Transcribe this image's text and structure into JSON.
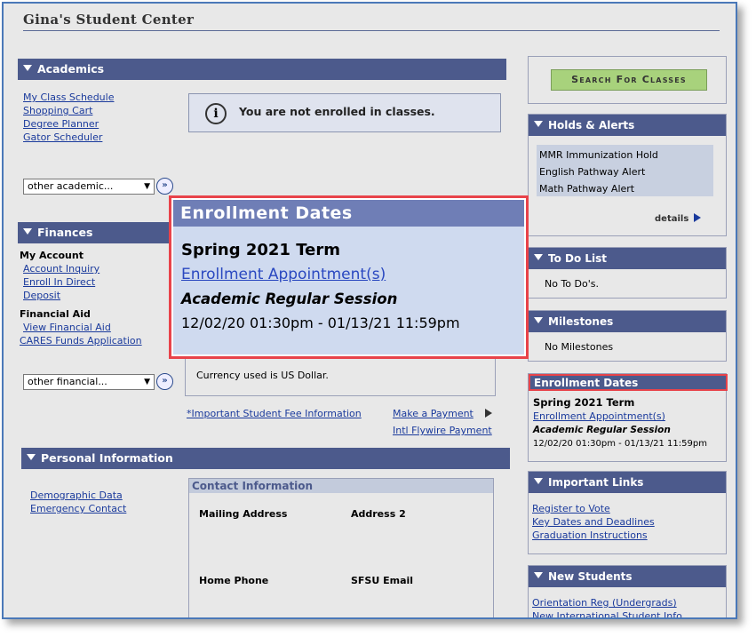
{
  "page_title": "Gina's Student Center",
  "academics": {
    "header": "Academics",
    "links": [
      "My Class Schedule",
      "Shopping Cart",
      "Degree Planner",
      "Gator Scheduler"
    ],
    "not_enrolled": "You are not enrolled in classes.",
    "other_select": "other academic..."
  },
  "finances": {
    "header": "Finances",
    "my_account_label": "My Account",
    "account_links": [
      "Account Inquiry",
      "Enroll In Direct",
      "Deposit"
    ],
    "financial_aid_label": "Financial Aid",
    "aid_links": [
      "View Financial Aid",
      "CARES Funds Application"
    ],
    "other_select": "other financial...",
    "currency_note": "Currency used is US Dollar.",
    "fee_info": "*Important Student Fee Information",
    "make_payment": "Make a Payment",
    "flywire": "Intl Flywire Payment"
  },
  "personal": {
    "header": "Personal Information",
    "links": [
      "Demographic Data",
      "Emergency Contact"
    ],
    "contact_header": "Contact Information",
    "mailing_address": "Mailing Address",
    "address2": "Address 2",
    "home_phone": "Home Phone",
    "sfsu_email": "SFSU Email"
  },
  "search_classes": "Search For Classes",
  "holds": {
    "header": "Holds & Alerts",
    "items": [
      "MMR Immunization Hold",
      "English Pathway Alert",
      "Math Pathway Alert"
    ],
    "details": "details"
  },
  "todo": {
    "header": "To Do List",
    "text": "No To Do's."
  },
  "milestones": {
    "header": "Milestones",
    "text": "No Milestones"
  },
  "enrollment": {
    "header": "Enrollment Dates",
    "term": "Spring 2021 Term",
    "appointment": "Enrollment Appointment(s)",
    "session": "Academic Regular Session",
    "dates": "12/02/20 01:30pm - 01/13/21 11:59pm"
  },
  "important_links": {
    "header": "Important Links",
    "links": [
      "Register to Vote",
      "Key Dates and Deadlines",
      "Graduation Instructions"
    ]
  },
  "new_students": {
    "header": "New Students",
    "links": [
      "Orientation Reg (Undergrads)",
      "New International Student Info"
    ]
  },
  "colors": {
    "header": "#4c5a8c",
    "highlight": "#e8434a",
    "button": "#a8d27c"
  }
}
